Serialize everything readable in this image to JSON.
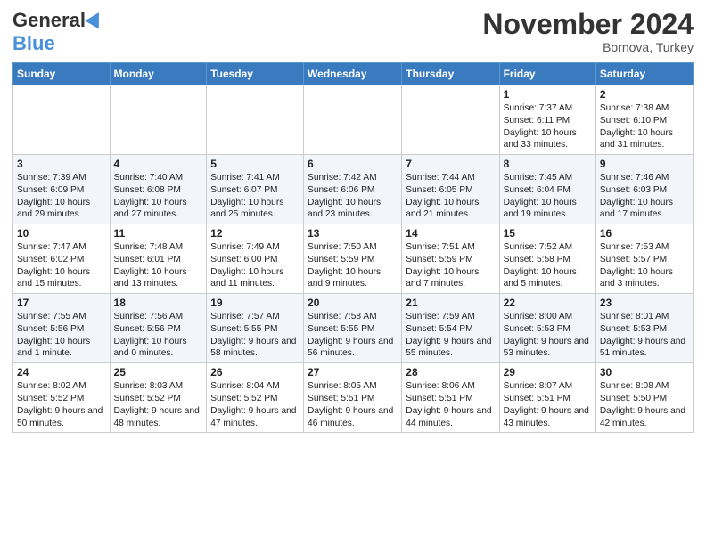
{
  "logo": {
    "general": "General",
    "blue": "Blue"
  },
  "header": {
    "month": "November 2024",
    "location": "Bornova, Turkey"
  },
  "weekdays": [
    "Sunday",
    "Monday",
    "Tuesday",
    "Wednesday",
    "Thursday",
    "Friday",
    "Saturday"
  ],
  "weeks": [
    [
      {
        "day": "",
        "content": ""
      },
      {
        "day": "",
        "content": ""
      },
      {
        "day": "",
        "content": ""
      },
      {
        "day": "",
        "content": ""
      },
      {
        "day": "",
        "content": ""
      },
      {
        "day": "1",
        "content": "Sunrise: 7:37 AM\nSunset: 6:11 PM\nDaylight: 10 hours and 33 minutes."
      },
      {
        "day": "2",
        "content": "Sunrise: 7:38 AM\nSunset: 6:10 PM\nDaylight: 10 hours and 31 minutes."
      }
    ],
    [
      {
        "day": "3",
        "content": "Sunrise: 7:39 AM\nSunset: 6:09 PM\nDaylight: 10 hours and 29 minutes."
      },
      {
        "day": "4",
        "content": "Sunrise: 7:40 AM\nSunset: 6:08 PM\nDaylight: 10 hours and 27 minutes."
      },
      {
        "day": "5",
        "content": "Sunrise: 7:41 AM\nSunset: 6:07 PM\nDaylight: 10 hours and 25 minutes."
      },
      {
        "day": "6",
        "content": "Sunrise: 7:42 AM\nSunset: 6:06 PM\nDaylight: 10 hours and 23 minutes."
      },
      {
        "day": "7",
        "content": "Sunrise: 7:44 AM\nSunset: 6:05 PM\nDaylight: 10 hours and 21 minutes."
      },
      {
        "day": "8",
        "content": "Sunrise: 7:45 AM\nSunset: 6:04 PM\nDaylight: 10 hours and 19 minutes."
      },
      {
        "day": "9",
        "content": "Sunrise: 7:46 AM\nSunset: 6:03 PM\nDaylight: 10 hours and 17 minutes."
      }
    ],
    [
      {
        "day": "10",
        "content": "Sunrise: 7:47 AM\nSunset: 6:02 PM\nDaylight: 10 hours and 15 minutes."
      },
      {
        "day": "11",
        "content": "Sunrise: 7:48 AM\nSunset: 6:01 PM\nDaylight: 10 hours and 13 minutes."
      },
      {
        "day": "12",
        "content": "Sunrise: 7:49 AM\nSunset: 6:00 PM\nDaylight: 10 hours and 11 minutes."
      },
      {
        "day": "13",
        "content": "Sunrise: 7:50 AM\nSunset: 5:59 PM\nDaylight: 10 hours and 9 minutes."
      },
      {
        "day": "14",
        "content": "Sunrise: 7:51 AM\nSunset: 5:59 PM\nDaylight: 10 hours and 7 minutes."
      },
      {
        "day": "15",
        "content": "Sunrise: 7:52 AM\nSunset: 5:58 PM\nDaylight: 10 hours and 5 minutes."
      },
      {
        "day": "16",
        "content": "Sunrise: 7:53 AM\nSunset: 5:57 PM\nDaylight: 10 hours and 3 minutes."
      }
    ],
    [
      {
        "day": "17",
        "content": "Sunrise: 7:55 AM\nSunset: 5:56 PM\nDaylight: 10 hours and 1 minute."
      },
      {
        "day": "18",
        "content": "Sunrise: 7:56 AM\nSunset: 5:56 PM\nDaylight: 10 hours and 0 minutes."
      },
      {
        "day": "19",
        "content": "Sunrise: 7:57 AM\nSunset: 5:55 PM\nDaylight: 9 hours and 58 minutes."
      },
      {
        "day": "20",
        "content": "Sunrise: 7:58 AM\nSunset: 5:55 PM\nDaylight: 9 hours and 56 minutes."
      },
      {
        "day": "21",
        "content": "Sunrise: 7:59 AM\nSunset: 5:54 PM\nDaylight: 9 hours and 55 minutes."
      },
      {
        "day": "22",
        "content": "Sunrise: 8:00 AM\nSunset: 5:53 PM\nDaylight: 9 hours and 53 minutes."
      },
      {
        "day": "23",
        "content": "Sunrise: 8:01 AM\nSunset: 5:53 PM\nDaylight: 9 hours and 51 minutes."
      }
    ],
    [
      {
        "day": "24",
        "content": "Sunrise: 8:02 AM\nSunset: 5:52 PM\nDaylight: 9 hours and 50 minutes."
      },
      {
        "day": "25",
        "content": "Sunrise: 8:03 AM\nSunset: 5:52 PM\nDaylight: 9 hours and 48 minutes."
      },
      {
        "day": "26",
        "content": "Sunrise: 8:04 AM\nSunset: 5:52 PM\nDaylight: 9 hours and 47 minutes."
      },
      {
        "day": "27",
        "content": "Sunrise: 8:05 AM\nSunset: 5:51 PM\nDaylight: 9 hours and 46 minutes."
      },
      {
        "day": "28",
        "content": "Sunrise: 8:06 AM\nSunset: 5:51 PM\nDaylight: 9 hours and 44 minutes."
      },
      {
        "day": "29",
        "content": "Sunrise: 8:07 AM\nSunset: 5:51 PM\nDaylight: 9 hours and 43 minutes."
      },
      {
        "day": "30",
        "content": "Sunrise: 8:08 AM\nSunset: 5:50 PM\nDaylight: 9 hours and 42 minutes."
      }
    ]
  ]
}
